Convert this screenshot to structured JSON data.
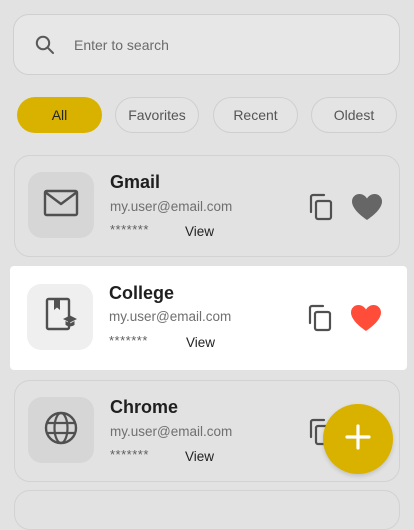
{
  "search": {
    "placeholder": "Enter to search",
    "value": ""
  },
  "filters": [
    {
      "label": "All",
      "active": true
    },
    {
      "label": "Favorites",
      "active": false
    },
    {
      "label": "Recent",
      "active": false
    },
    {
      "label": "Oldest",
      "active": false
    }
  ],
  "accounts": [
    {
      "title": "Gmail",
      "email": "my.user@email.com",
      "password_mask": "*******",
      "view_label": "View",
      "icon": "mail-icon",
      "favorite": true,
      "favorite_color": "#666666"
    },
    {
      "title": "College",
      "email": "my.user@email.com",
      "password_mask": "*******",
      "view_label": "View",
      "icon": "college-book-icon",
      "favorite": true,
      "favorite_color": "#ff4d3a"
    },
    {
      "title": "Chrome",
      "email": "my.user@email.com",
      "password_mask": "*******",
      "view_label": "View",
      "icon": "globe-icon",
      "favorite": false
    }
  ],
  "colors": {
    "accent": "#d9b200",
    "favorite_active": "#ff4d3a",
    "favorite_dim": "#666666",
    "scrim": "#e2e2e2"
  },
  "fab": {
    "icon": "plus-icon"
  }
}
